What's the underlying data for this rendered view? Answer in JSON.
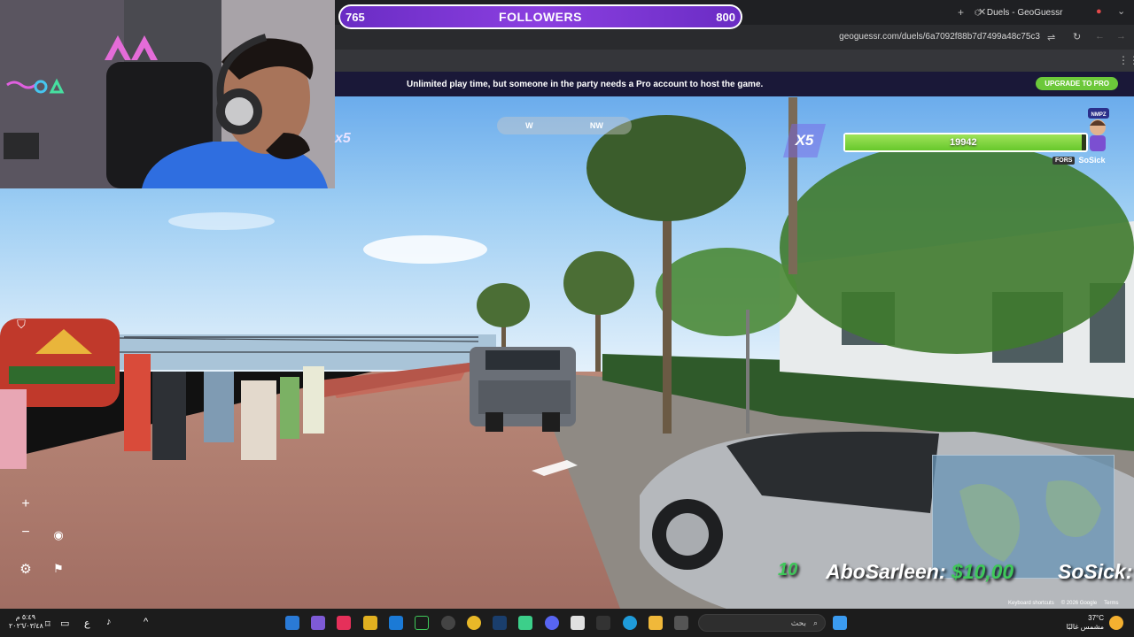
{
  "browser": {
    "tab_title": "Duels - GeoGuessr",
    "url": "geoguessr.com/duels/6a7092f88b7d7499a48c75c3"
  },
  "followers": {
    "current": "765",
    "label": "FOLLOWERS",
    "goal": "800"
  },
  "promo": {
    "message": "Unlimited play time, but someone in the party needs a Pro account to host the game.",
    "button": "UPGRADE TO PRO"
  },
  "hud": {
    "compass_left": "W",
    "compass_right": "NW",
    "multiplier_left": "x5",
    "multiplier_right": "X5",
    "health_value": "19942",
    "health_fraction": 0.98,
    "player_badge": "FORS",
    "player_name": "SoSick",
    "avatar_tag": "NMPZ"
  },
  "controls": {
    "zoom_in": "+",
    "zoom_out": "−"
  },
  "overlay": {
    "score_left": "10",
    "name_left": "AboSarleen:",
    "name_left_score": "$10,00",
    "name_right": "SoSick:"
  },
  "map_attribution": {
    "google": "Google",
    "shortcuts": "Keyboard shortcuts",
    "copyright": "© 2026 Google",
    "terms": "Terms"
  },
  "taskbar": {
    "time": "٥:٤٩ م",
    "date": "٢٠٢٦/٠٣/٤٨",
    "search_placeholder": "بحث",
    "weather_temp": "37°C",
    "weather_desc": "مشمس غالبًا",
    "lang": "ع"
  },
  "colors": {
    "followers_purple": "#7a35d4",
    "health_green": "#7fd63f",
    "promo_bg": "#1a1838",
    "upgrade_green": "#6cc83a"
  }
}
